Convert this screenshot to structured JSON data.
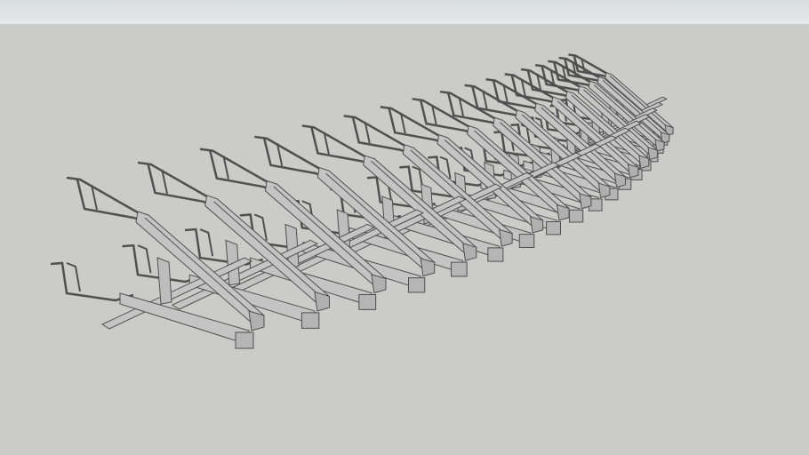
{
  "scene": {
    "sky_color": "#e6e9ea",
    "ground_color": "#cbcbc8",
    "model_fill": "#c4c4c4",
    "model_edge": "#505050",
    "unit_count": 17
  }
}
